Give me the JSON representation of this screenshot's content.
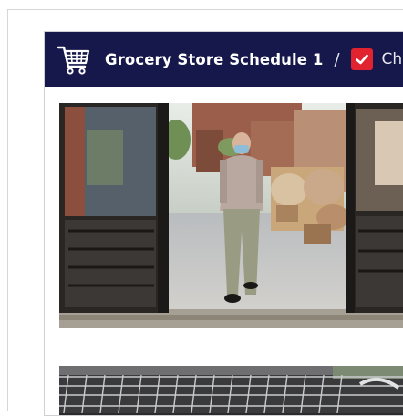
{
  "header": {
    "title": "Grocery Store Schedule 1",
    "separator": "/",
    "checklist_label": "Ch",
    "background_color": "#16174a",
    "checkbox_color": "#e0232f"
  },
  "icons": {
    "cart": "shopping-cart-icon",
    "checkbox": "checkbox-checked-icon"
  },
  "photos": [
    {
      "subject": "shopper-in-mask-entering-store"
    },
    {
      "subject": "row-of-shopping-carts"
    }
  ]
}
